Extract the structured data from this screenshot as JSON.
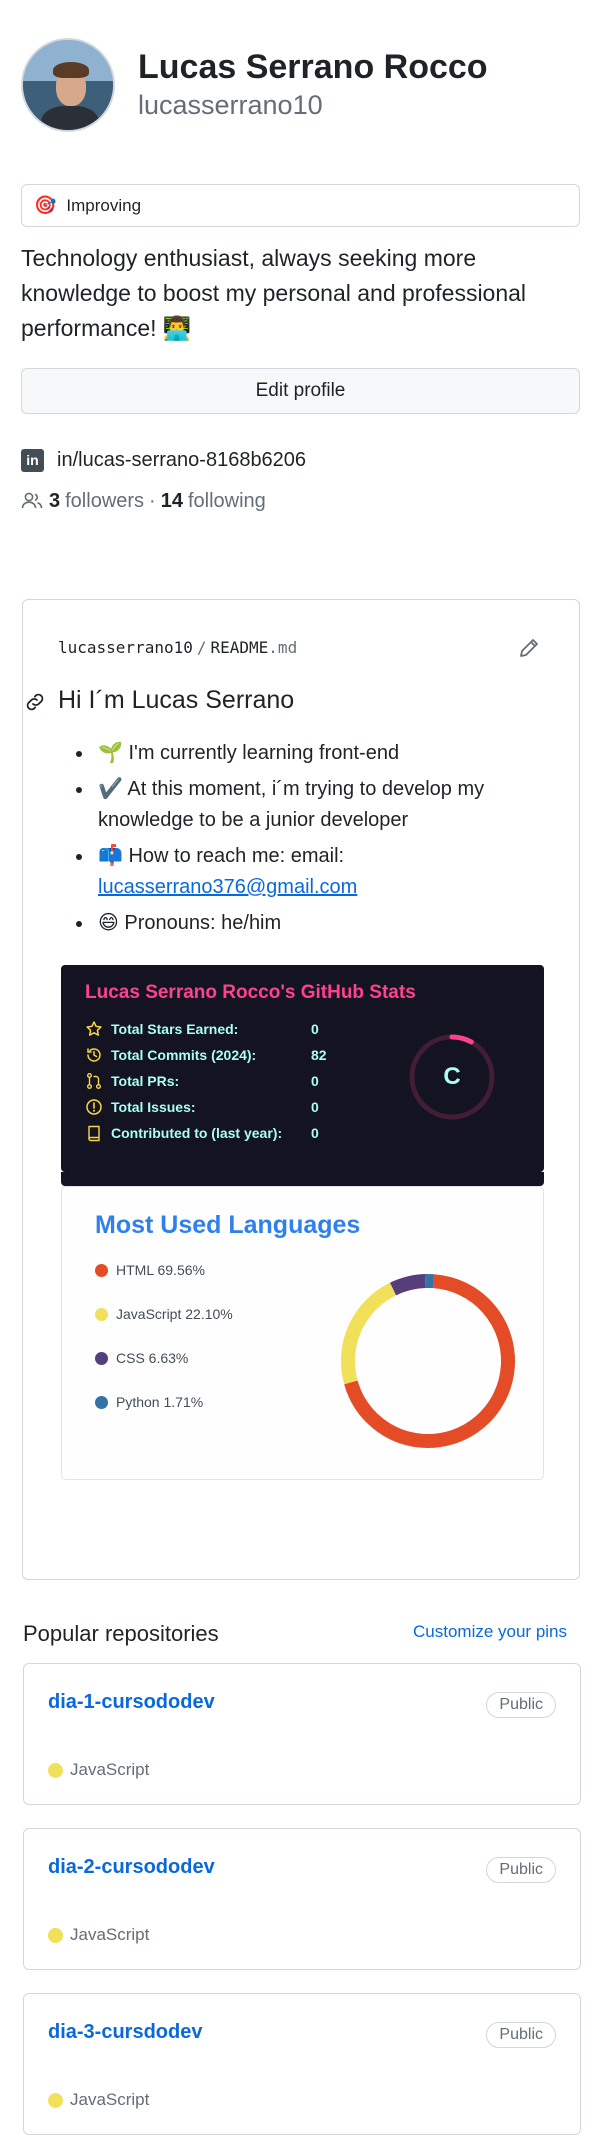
{
  "profile": {
    "full_name": "Lucas Serrano Rocco",
    "username": "lucasserrano10",
    "status_emoji": "🎯",
    "status_text": "Improving",
    "bio": "Technology enthusiast, always seeking more knowledge to boost my personal and professional performance! 👨‍💻",
    "edit_label": "Edit profile",
    "linkedin_text": "in/lucas-serrano-8168b6206",
    "followers_count": "3",
    "followers_label": "followers",
    "following_count": "14",
    "following_label": "following",
    "separator": "·"
  },
  "readme": {
    "path_user": "lucasserrano10",
    "path_sep": "/",
    "path_file": "README",
    "path_ext": ".md",
    "heading": "Hi I´m Lucas Serrano",
    "items": [
      "🌱 I'm currently learning front-end",
      "✔️ At this moment, i´m trying to develop my knowledge to be a junior developer",
      "📫 How to reach me: email:",
      "😄 Pronouns: he/him"
    ],
    "email": "lucasserrano376@gmail.com",
    "stats": {
      "title": "Lucas Serrano Rocco's GitHub Stats",
      "rows": [
        {
          "label": "Total Stars Earned:",
          "value": "0",
          "icon": "star-icon"
        },
        {
          "label": "Total Commits (2024):",
          "value": "82",
          "icon": "history-icon"
        },
        {
          "label": "Total PRs:",
          "value": "0",
          "icon": "pull-request-icon"
        },
        {
          "label": "Total Issues:",
          "value": "0",
          "icon": "issue-icon"
        },
        {
          "label": "Contributed to (last year):",
          "value": "0",
          "icon": "repo-icon"
        }
      ],
      "grade": "C",
      "grade_progress": 0.08,
      "colors": {
        "bg": "#141321",
        "title": "#fe428e",
        "text": "#a9fef7",
        "icon": "#f8d847",
        "ring": "#fe428e"
      }
    },
    "languages": {
      "title": "Most Used Languages",
      "items": [
        {
          "label": "HTML 69.56%",
          "value": 69.56,
          "color": "#e34c26"
        },
        {
          "label": "JavaScript 22.10%",
          "value": 22.1,
          "color": "#f1e05a"
        },
        {
          "label": "CSS 6.63%",
          "value": 6.63,
          "color": "#563d7c"
        },
        {
          "label": "Python 1.71%",
          "value": 1.71,
          "color": "#3572A5"
        }
      ]
    }
  },
  "popular": {
    "title": "Popular repositories",
    "customize": "Customize your pins",
    "repos": [
      {
        "name": "dia-1-cursododev",
        "visibility": "Public",
        "language": "JavaScript",
        "lang_color": "#f1e05a"
      },
      {
        "name": "dia-2-cursododev",
        "visibility": "Public",
        "language": "JavaScript",
        "lang_color": "#f1e05a"
      },
      {
        "name": "dia-3-cursdodev",
        "visibility": "Public",
        "language": "JavaScript",
        "lang_color": "#f1e05a"
      }
    ]
  }
}
